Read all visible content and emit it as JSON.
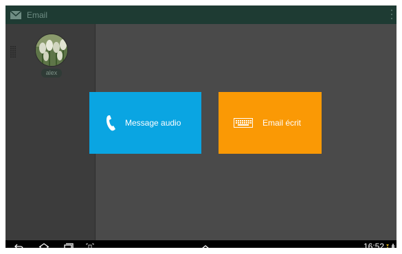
{
  "action_bar": {
    "title": "Email",
    "app_icon": "envelope-icon",
    "overflow_icon": "overflow-menu-icon"
  },
  "contacts": [
    {
      "name": "alex",
      "avatar": "tulip-photo"
    }
  ],
  "tiles": {
    "audio": {
      "label": "Message audio",
      "icon": "phone-handset-icon",
      "color": "#0aa5e2"
    },
    "email": {
      "label": "Email écrit",
      "icon": "keyboard-icon",
      "color": "#fa9905"
    }
  },
  "system_bar": {
    "time": "16:52",
    "buttons": [
      "back-icon",
      "home-icon",
      "recent-apps-icon",
      "screenshot-icon",
      "expand-up-icon"
    ]
  },
  "colors": {
    "action_bar": "#1e3b33",
    "left_panel": "#3c3c3c",
    "main_bg": "#4a4a4a"
  }
}
